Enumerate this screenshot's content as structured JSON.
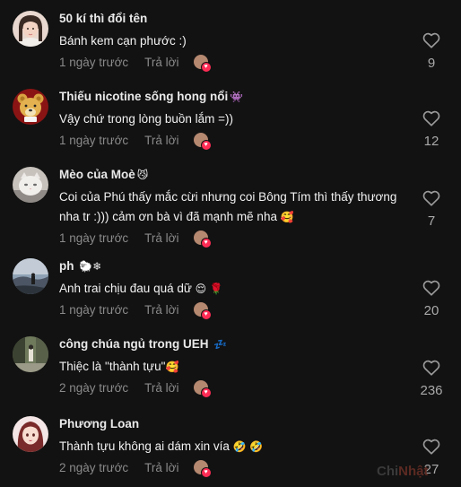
{
  "comments": [
    {
      "name": "50 kí thì đổi tên",
      "name_emoji": "",
      "text": "Bánh kem cạn phước :)",
      "text_emoji": "",
      "time": "1 ngày trước",
      "reply": "Trả lời",
      "likes": "9",
      "avatar_icon": "girl-selfie-avatar"
    },
    {
      "name": "Thiếu nicotine sống hong nổi",
      "name_emoji": "👾",
      "text": "Vậy chứ trong lòng buồn lắm =))",
      "text_emoji": "",
      "time": "1 ngày trước",
      "reply": "Trả lời",
      "likes": "12",
      "avatar_icon": "teddy-bear-avatar"
    },
    {
      "name": "Mèo của Moè",
      "name_emoji": "😼",
      "text": "Coi của Phú thấy mắc cừi nhưng coi Bông Tím thì thấy thương nha tr :))) cảm ơn bà vì đã mạnh mẽ nha",
      "text_emoji": "🥰",
      "time": "1 ngày trước",
      "reply": "Trả lời",
      "likes": "7",
      "avatar_icon": "cat-avatar"
    },
    {
      "name": "ph",
      "name_emoji": "🐑❄",
      "text": "Anh trai chịu đau quá dữ",
      "text_emoji": "😌 🌹",
      "time": "1 ngày trước",
      "reply": "Trả lời",
      "likes": "20",
      "avatar_icon": "landscape-avatar"
    },
    {
      "name": "công chúa ngủ trong UEH",
      "name_emoji": "💤",
      "text": "Thiệc là \"thành tựu\"",
      "text_emoji": "🥰",
      "time": "2 ngày trước",
      "reply": "Trả lời",
      "likes": "236",
      "avatar_icon": "street-avatar"
    },
    {
      "name": "Phương Loan",
      "name_emoji": "",
      "text": "Thành tựu không ai dám xin vía",
      "text_emoji": "🤣 🤣",
      "time": "2 ngày trước",
      "reply": "Trả lời",
      "likes": "27",
      "avatar_icon": "anime-girl-avatar"
    }
  ],
  "watermark": {
    "part1": "Chi",
    "part2": "Nhật"
  },
  "colors": {
    "background": "#121212",
    "name": "#e9e9e9",
    "text": "#f2f2f2",
    "meta": "#8a8a8a",
    "creator_heart": "#fe2c55"
  }
}
